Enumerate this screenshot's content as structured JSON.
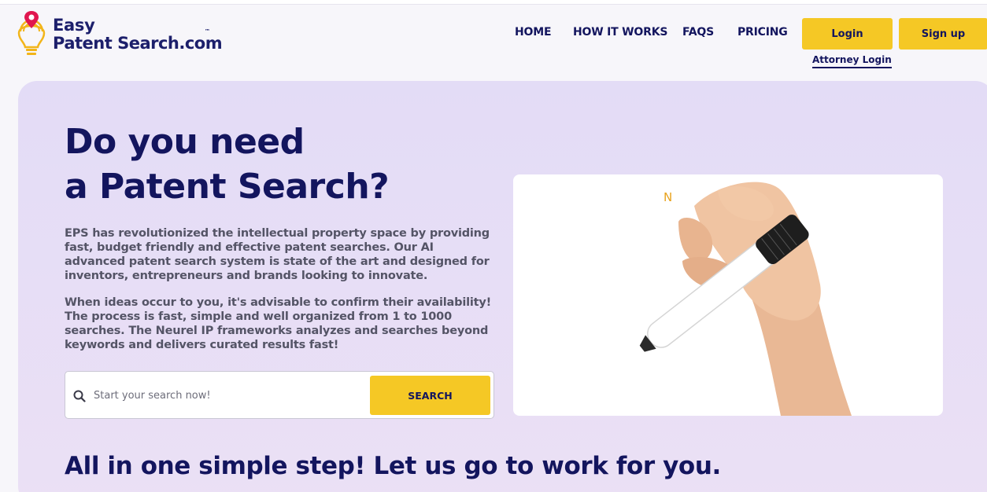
{
  "brand": {
    "line1": "Easy",
    "line2": "Patent Search.com",
    "tm": "™",
    "colors": {
      "navy": "#13155e",
      "yellow": "#f5c825",
      "pin": "#e0164f",
      "bulb": "#f2b51a"
    }
  },
  "nav": {
    "home": "HOME",
    "how_it_works": "HOW IT WORKS",
    "faqs": "FAQS",
    "pricing": "PRICING",
    "login": "Login",
    "signup": "Sign up",
    "attorney_login": "Attorney Login"
  },
  "hero": {
    "title_line1": "Do you need",
    "title_line2": "a Patent Search?",
    "paragraph1": "EPS has revolutionized the intellectual property space by providing fast, budget friendly and effective patent searches. Our AI advanced patent search system is state of the art and designed for inventors, entrepreneurs and brands looking to innovate.",
    "paragraph2": "When ideas occur to you, it's advisable to confirm their availability! The process is fast, simple and well organized from 1 to 1000 searches. The Neurel IP frameworks analyzes and searches beyond keywords and delivers curated results fast!",
    "search": {
      "icon": "search-icon",
      "placeholder": "Start your search now!",
      "value": "",
      "button": "SEARCH"
    },
    "video": {
      "letter": "N",
      "content": "hand-holding-marker"
    }
  },
  "subheading": "All in one simple step! Let us go to work for you."
}
